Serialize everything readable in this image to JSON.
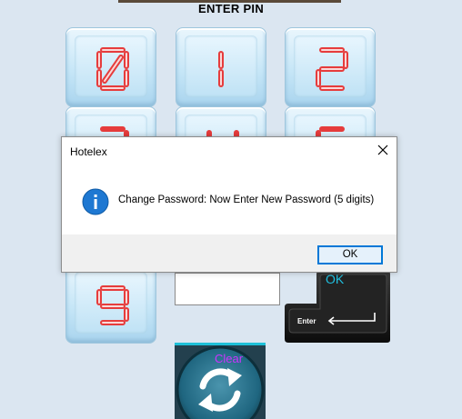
{
  "screen": {
    "title": "ENTER PIN"
  },
  "keypad": {
    "keys": [
      {
        "digit": "0"
      },
      {
        "digit": "1"
      },
      {
        "digit": "2"
      },
      {
        "digit": "3"
      },
      {
        "digit": "4"
      },
      {
        "digit": "5"
      },
      {
        "digit": "9"
      }
    ]
  },
  "pin_field": {
    "value": ""
  },
  "enter_key": {
    "top_label": "OK",
    "key_label": "Enter"
  },
  "clear_button": {
    "label": "Clear"
  },
  "dialog": {
    "title": "Hotelex",
    "message": "Change Password: Now Enter New Password (5 digits)",
    "ok_label": "OK",
    "icon": "info-icon"
  },
  "colors": {
    "digit_red": "#e63c3c",
    "dialog_accent": "#0078d7",
    "ok_text": "#20c0e0",
    "clear_text": "#cc33ff"
  }
}
